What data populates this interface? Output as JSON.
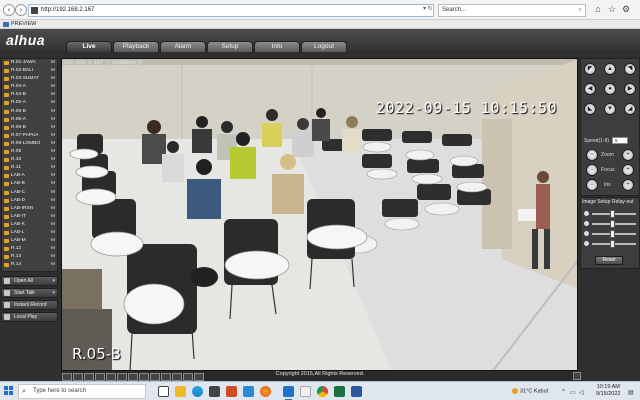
{
  "browser": {
    "url": "http://192.168.2.167",
    "search_placeholder": "Search...",
    "tab_title": "PREVIEW"
  },
  "app": {
    "logo": "alhua",
    "tabs": [
      {
        "label": "Live",
        "active": true
      },
      {
        "label": "Playback"
      },
      {
        "label": "Alarm"
      },
      {
        "label": "Setup"
      },
      {
        "label": "Info"
      },
      {
        "label": "Logout"
      }
    ]
  },
  "channels": [
    {
      "name": "R.01-JAWA",
      "flag": "M"
    },
    {
      "name": "R.02-BALI",
      "flag": "M"
    },
    {
      "name": "R.03-SUMAT",
      "flag": "M"
    },
    {
      "name": "R.04-A",
      "flag": "M"
    },
    {
      "name": "R.04-B",
      "flag": "M"
    },
    {
      "name": "R.05-A",
      "flag": "M"
    },
    {
      "name": "R.05-B",
      "flag": "M"
    },
    {
      "name": "R.06-A",
      "flag": "M"
    },
    {
      "name": "R.06-B",
      "flag": "M"
    },
    {
      "name": "R.07-PAPUA",
      "flag": "M"
    },
    {
      "name": "R.08-LOMBO",
      "flag": "M"
    },
    {
      "name": "R.09",
      "flag": "M"
    },
    {
      "name": "R.10",
      "flag": "M"
    },
    {
      "name": "R.11",
      "flag": "M"
    },
    {
      "name": "LAB-A",
      "flag": "M"
    },
    {
      "name": "LAB-B",
      "flag": "M"
    },
    {
      "name": "LAB-C",
      "flag": "M"
    },
    {
      "name": "LAB-D",
      "flag": "M"
    },
    {
      "name": "LAB-IRSN",
      "flag": "M"
    },
    {
      "name": "LAB-IT",
      "flag": "M"
    },
    {
      "name": "LAB-K",
      "flag": "M"
    },
    {
      "name": "LAB-L",
      "flag": "M"
    },
    {
      "name": "LAB-M",
      "flag": "M"
    },
    {
      "name": "R.12",
      "flag": "M"
    },
    {
      "name": "R.13",
      "flag": "M"
    },
    {
      "name": "R.14",
      "flag": "M"
    }
  ],
  "actions": [
    {
      "label": "Open All",
      "dropdown": true
    },
    {
      "label": "Start Talk",
      "dropdown": true
    },
    {
      "label": "Instant Record",
      "dropdown": false
    },
    {
      "label": "Local Play",
      "dropdown": false
    }
  ],
  "video": {
    "stream_info": "192.168.2.167_7 1869Kbps_H",
    "osd_time": "2022-09-15  10:15:50",
    "osd_name": "R.05-B"
  },
  "ptz": {
    "speed_label": "Speed(1-8)",
    "speed_value": "5",
    "zoom_label": "Zoom",
    "focus_label": "Focus",
    "iris_label": "Iris"
  },
  "image_setup": {
    "tab_image": "Image Setup",
    "tab_relay": "Relay-out",
    "reset_label": "Reset"
  },
  "footer": {
    "copyright": "Copyright 2015,All Rights Reserved."
  },
  "taskbar": {
    "search_placeholder": "Type here to search",
    "weather": "31°C  Kabut",
    "time": "10:19 AM",
    "date": "9/15/2022"
  }
}
